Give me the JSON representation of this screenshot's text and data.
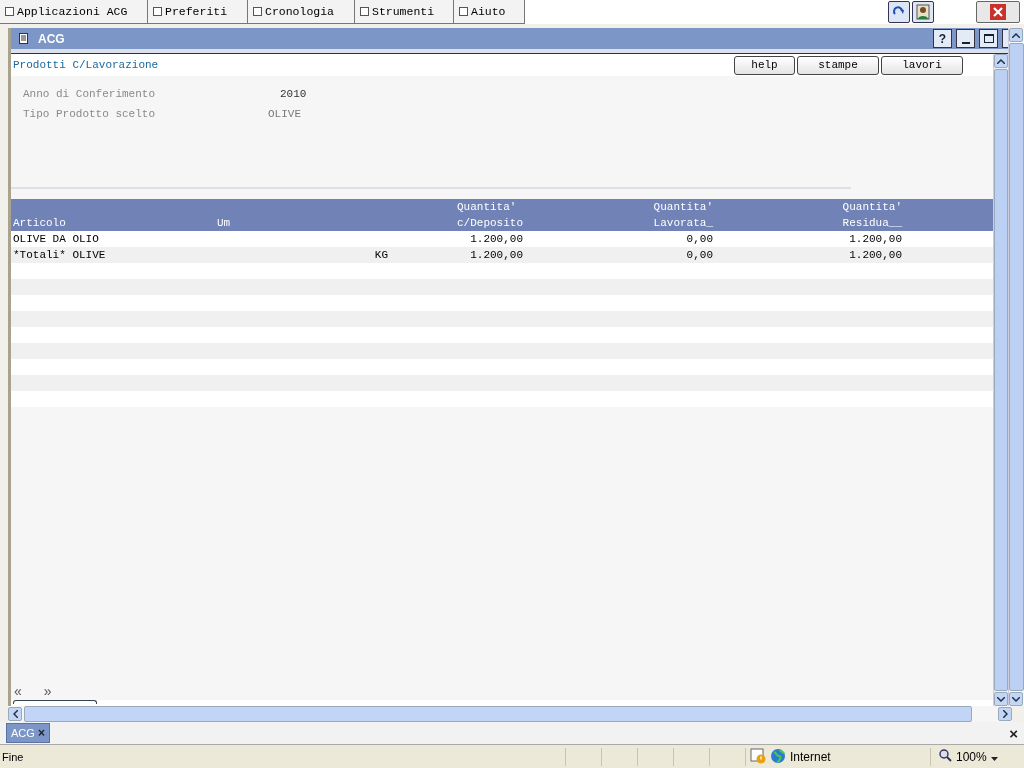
{
  "menu": [
    {
      "label": "Applicazioni ACG"
    },
    {
      "label": "Preferiti"
    },
    {
      "label": "Cronologia"
    },
    {
      "label": "Strumenti"
    },
    {
      "label": "Aiuto"
    }
  ],
  "window": {
    "title": "ACG",
    "help": "?"
  },
  "page": {
    "title": "Prodotti C/Lavorazione",
    "buttons": [
      "help",
      "stampe",
      "lavori"
    ],
    "fields": [
      {
        "label": "Anno di Conferimento",
        "value": "2010"
      },
      {
        "label": "Tipo Prodotto scelto",
        "value": "OLIVE"
      }
    ],
    "table": {
      "columns": [
        {
          "lines": [
            "Articolo"
          ]
        },
        {
          "lines": [
            "Um"
          ]
        },
        {
          "lines": [
            "Quantita'",
            "c/Deposito"
          ]
        },
        {
          "lines": [
            "Quantita'",
            "Lavorata_"
          ]
        },
        {
          "lines": [
            "Quantita'",
            "Residua__"
          ]
        }
      ],
      "rows": [
        [
          "OLIVE DA OLIO",
          "",
          "1.200,00",
          "0,00",
          "1.200,00"
        ],
        [
          "*Totali* OLIVE",
          "KG",
          "1.200,00",
          "0,00",
          "1.200,00"
        ]
      ]
    },
    "nav": {
      "previous": "«",
      "next": "»"
    }
  },
  "tabs": [
    {
      "label": "ACG",
      "close": "×",
      "selected": true
    }
  ],
  "tab_bar_close": "×",
  "status_bar": {
    "text": "Fine",
    "zone": "Internet",
    "zoom": "100%"
  }
}
